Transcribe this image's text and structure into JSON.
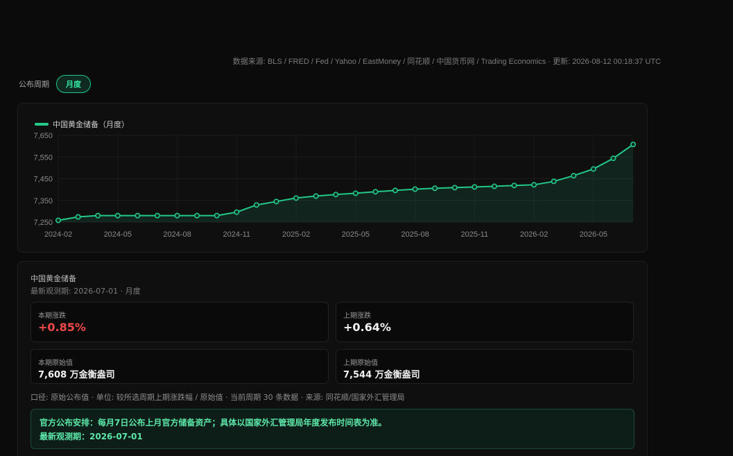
{
  "header": {
    "source_text": "数据来源: BLS / FRED / Fed / Yahoo / EastMoney / 同花顺 / 中国货币网 / Trading Economics · 更新: 2026-08-12 00:18:37 UTC"
  },
  "period": {
    "label": "公布周期",
    "selected": "月度"
  },
  "colors": {
    "accent": "#22c98a",
    "positive_red": "#ef4a4a"
  },
  "chart_data": {
    "type": "area",
    "title": "",
    "xlabel": "",
    "ylabel": "",
    "ylim": [
      7250,
      7650
    ],
    "yticks": [
      7250,
      7350,
      7450,
      7550,
      7650
    ],
    "ytick_labels": [
      "7,250",
      "7,350",
      "7,450",
      "7,550",
      "7,650"
    ],
    "xtick_labels": [
      "2024-02",
      "2024-05",
      "2024-08",
      "2024-11",
      "2025-02",
      "2025-05",
      "2025-08",
      "2025-11",
      "2026-02",
      "2026-05"
    ],
    "grid": true,
    "legend_position": "top-left",
    "series": [
      {
        "name": "中国黄金储备（月度）",
        "x": [
          "2024-02",
          "2024-03",
          "2024-04",
          "2024-05",
          "2024-06",
          "2024-07",
          "2024-08",
          "2024-09",
          "2024-10",
          "2024-11",
          "2024-12",
          "2025-01",
          "2025-02",
          "2025-03",
          "2025-04",
          "2025-05",
          "2025-06",
          "2025-07",
          "2025-08",
          "2025-09",
          "2025-10",
          "2025-11",
          "2025-12",
          "2026-01",
          "2026-02",
          "2026-03",
          "2026-04",
          "2026-05",
          "2026-06",
          "2026-07"
        ],
        "values": [
          7258,
          7274,
          7280,
          7280,
          7280,
          7280,
          7280,
          7280,
          7280,
          7296,
          7329,
          7345,
          7361,
          7370,
          7377,
          7383,
          7390,
          7396,
          7402,
          7406,
          7409,
          7412,
          7415,
          7419,
          7422,
          7438,
          7464,
          7495,
          7544,
          7608
        ]
      }
    ]
  },
  "summary": {
    "title": "中国黄金储备",
    "subtitle": "最新观测期: 2026-07-01 · 月度",
    "current_change_label": "本期涨跌",
    "current_change_value": "+0.85%",
    "previous_change_label": "上期涨跌",
    "previous_change_value": "+0.64%",
    "current_raw_label": "本期原始值",
    "current_raw_value": "7,608 万金衡盎司",
    "previous_raw_label": "上期原始值",
    "previous_raw_value": "7,544 万金衡盎司",
    "note": "口径: 原始公布值 · 单位: 较所选周期上期涨跌幅 / 原始值 · 当前周期 30 条数据 · 来源: 同花顺/国家外汇管理局"
  },
  "schedule": {
    "line1": "官方公布安排：每月7日公布上月官方储备资产；具体以国家外汇管理局年度发布时间表为准。",
    "line2": "最新观测期：2026-07-01"
  }
}
